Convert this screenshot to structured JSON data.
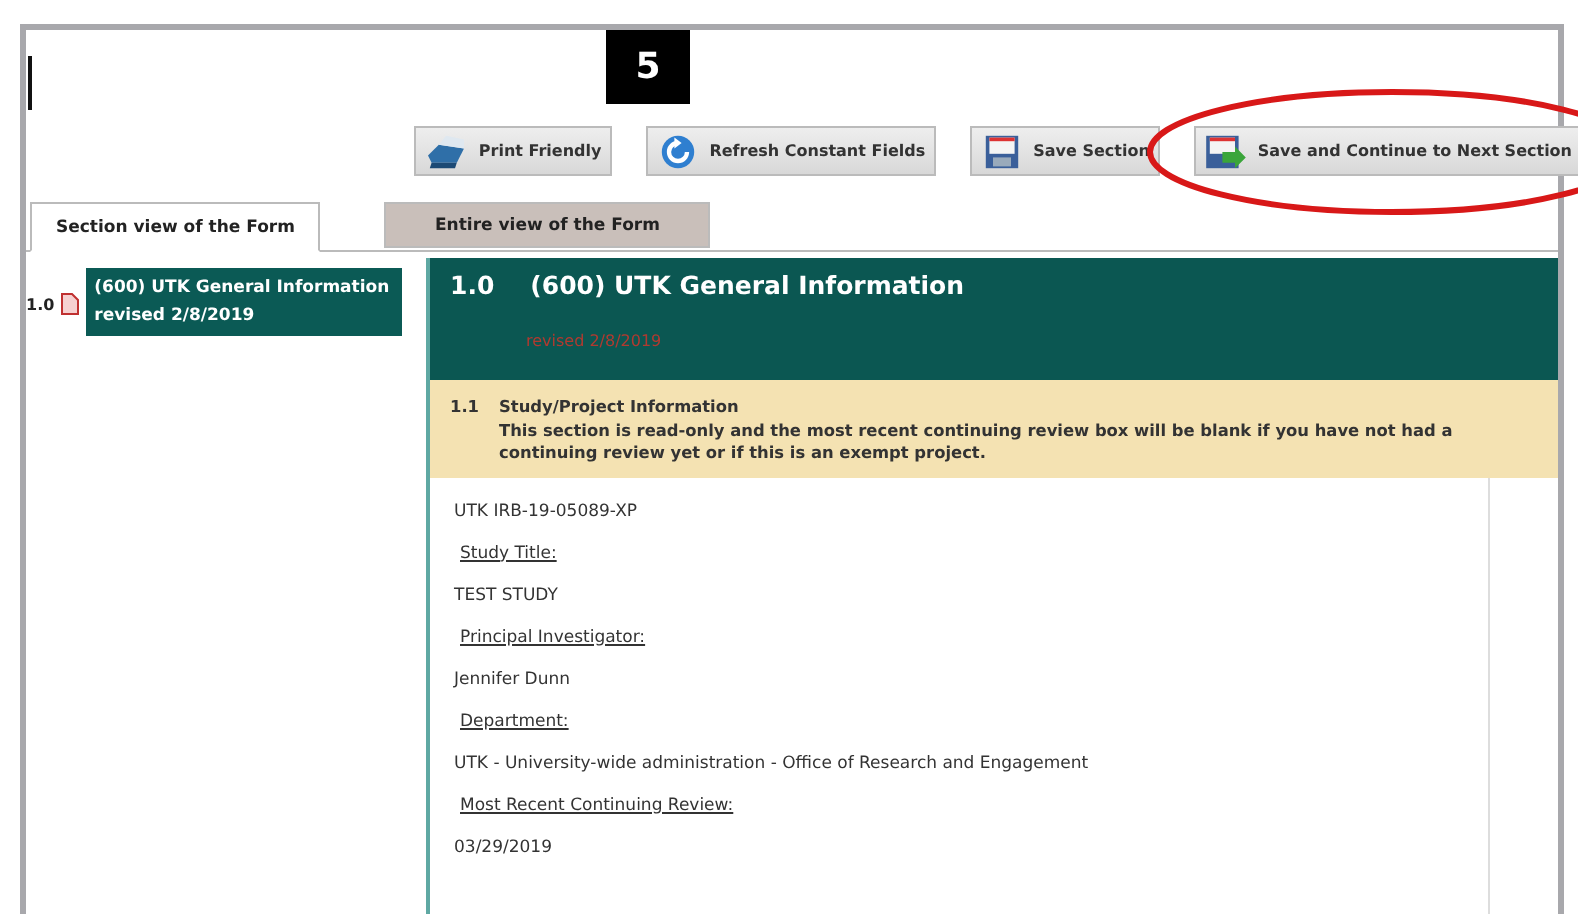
{
  "step_badge": "5",
  "toolbar": [
    {
      "label": "Print Friendly",
      "kind": "printer",
      "circled": false
    },
    {
      "label": "Refresh Constant Fields",
      "kind": "refresh",
      "circled": false
    },
    {
      "label": "Save Section",
      "kind": "save",
      "circled": false
    },
    {
      "label": "Save and Continue to Next Section",
      "kind": "save-next",
      "circled": true
    }
  ],
  "tabs": [
    {
      "label": "Section view of the Form",
      "selected": true
    },
    {
      "label": "Entire view of the Form",
      "selected": false
    }
  ],
  "sidebar": {
    "items": [
      {
        "number": "1.0",
        "label": "(600) UTK General Information revised 2/8/2019",
        "selected": true
      }
    ]
  },
  "section": {
    "number": "1.0",
    "title": "(600) UTK General Information",
    "revised": "revised 2/8/2019"
  },
  "subsection": {
    "number": "1.1",
    "title": "Study/Project Information",
    "note": "This section is read-only and the most recent continuing review box will be blank if you have not had a continuing review yet or if this is an exempt project."
  },
  "fields": [
    {
      "kind": "value",
      "text": "UTK IRB-19-05089-XP"
    },
    {
      "kind": "label",
      "text": "Study Title:"
    },
    {
      "kind": "value",
      "text": "TEST STUDY"
    },
    {
      "kind": "label",
      "text": "Principal Investigator:"
    },
    {
      "kind": "value",
      "text": "Jennifer Dunn"
    },
    {
      "kind": "label",
      "text": "Department:"
    },
    {
      "kind": "value",
      "text": "UTK - University-wide administration - Office of Research and Engagement"
    },
    {
      "kind": "label",
      "text": "Most Recent Continuing Review:"
    },
    {
      "kind": "value",
      "text": "03/29/2019"
    }
  ]
}
